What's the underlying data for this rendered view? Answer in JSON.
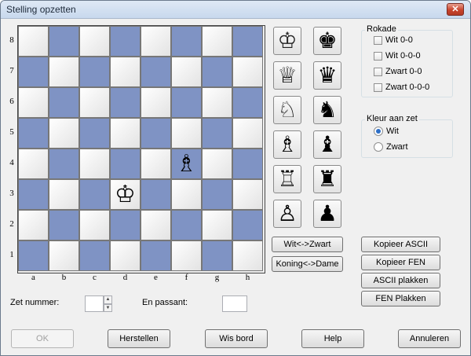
{
  "window": {
    "title": "Stelling opzetten",
    "close_label": "✕"
  },
  "board": {
    "ranks": [
      "8",
      "7",
      "6",
      "5",
      "4",
      "3",
      "2",
      "1"
    ],
    "files": [
      "a",
      "b",
      "c",
      "d",
      "e",
      "f",
      "g",
      "h"
    ],
    "pieces": [
      {
        "square": "f4",
        "piece": "white-bishop",
        "glyph": "♗"
      },
      {
        "square": "d3",
        "piece": "white-king",
        "glyph": "♔"
      }
    ],
    "light_color": "#ffffff",
    "dark_color": "#7f93c4"
  },
  "palette": {
    "white": [
      {
        "name": "white-king",
        "glyph": "♔"
      },
      {
        "name": "white-queen",
        "glyph": "♕"
      },
      {
        "name": "white-knight",
        "glyph": "♘"
      },
      {
        "name": "white-bishop",
        "glyph": "♗"
      },
      {
        "name": "white-rook",
        "glyph": "♖"
      },
      {
        "name": "white-pawn",
        "glyph": "♙"
      }
    ],
    "black": [
      {
        "name": "black-king",
        "glyph": "♚"
      },
      {
        "name": "black-queen",
        "glyph": "♛"
      },
      {
        "name": "black-knight",
        "glyph": "♞"
      },
      {
        "name": "black-bishop",
        "glyph": "♝"
      },
      {
        "name": "black-rook",
        "glyph": "♜"
      },
      {
        "name": "black-pawn",
        "glyph": "♟"
      }
    ]
  },
  "board_buttons": {
    "swap_colors": "Wit<->Zwart",
    "king_queen": "Koning<->Dame"
  },
  "castling": {
    "legend": "Rokade",
    "options": [
      {
        "label": "Wit 0-0",
        "checked": false
      },
      {
        "label": "Wit 0-0-0",
        "checked": false
      },
      {
        "label": "Zwart 0-0",
        "checked": false
      },
      {
        "label": "Zwart 0-0-0",
        "checked": false
      }
    ]
  },
  "side_to_move": {
    "legend": "Kleur aan zet",
    "options": [
      {
        "label": "Wit",
        "selected": true
      },
      {
        "label": "Zwart",
        "selected": false
      }
    ]
  },
  "copy_buttons": {
    "copy_ascii": "Kopieer ASCII",
    "copy_fen": "Kopieer FEN",
    "paste_ascii": "ASCII plakken",
    "paste_fen": "FEN Plakken"
  },
  "move_number": {
    "label": "Zet nummer:",
    "value": ""
  },
  "en_passant": {
    "label": "En passant:",
    "value": ""
  },
  "footer": {
    "ok": "OK",
    "restore": "Herstellen",
    "clear": "Wis bord",
    "help": "Help",
    "cancel": "Annuleren"
  }
}
